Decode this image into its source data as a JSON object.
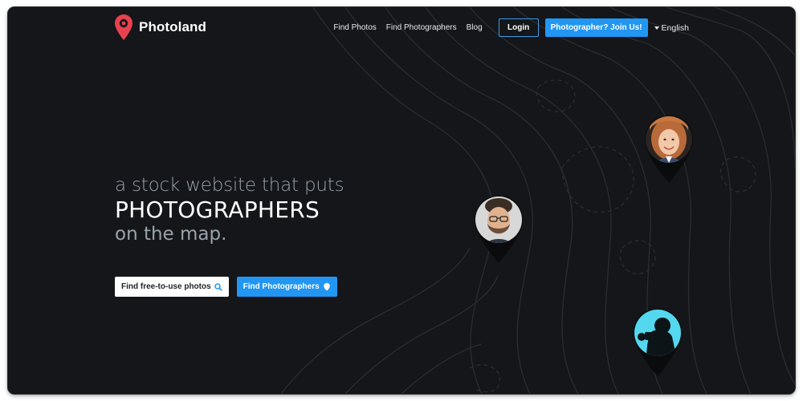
{
  "app": {
    "name": "Photoland"
  },
  "nav": {
    "links": [
      "Find Photos",
      "Find Photographers",
      "Blog"
    ],
    "login_label": "Login",
    "join_label": "Photographer? Join Us!",
    "language": "English"
  },
  "hero": {
    "line1": "a stock website that puts",
    "line2": "PHOTOGRAPHERS",
    "line3": "on the map."
  },
  "cta": {
    "photos_label": "Find free-to-use photos",
    "photographers_label": "Find Photographers"
  },
  "colors": {
    "background": "#141619",
    "accent": "#2196f3",
    "brand_pin": "#e8414f"
  },
  "icons": [
    "map-pin-icon",
    "search-icon",
    "balloon-pin-icon",
    "caret-down-icon"
  ],
  "map_pins": [
    {
      "avatar": "woman-photographer-avatar"
    },
    {
      "avatar": "man-photographer-avatar"
    },
    {
      "avatar": "silhouette-photographer-avatar"
    }
  ]
}
